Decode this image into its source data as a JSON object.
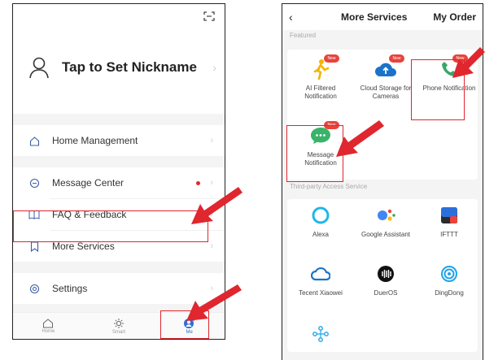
{
  "left_phone": {
    "nickname": "Tap to Set Nickname",
    "menu": [
      {
        "label": "Home Management",
        "icon": "home-icon"
      },
      {
        "label": "Message Center",
        "icon": "message-icon",
        "has_dot": true
      },
      {
        "label": "FAQ & Feedback",
        "icon": "book-icon"
      },
      {
        "label": "More Services",
        "icon": "bookmark-icon",
        "highlighted": true
      },
      {
        "label": "Settings",
        "icon": "settings-icon"
      }
    ],
    "tabs": [
      {
        "label": "Home",
        "icon": "home-tab-icon"
      },
      {
        "label": "Smart",
        "icon": "sun-icon"
      },
      {
        "label": "Me",
        "icon": "me-icon",
        "active": true
      }
    ]
  },
  "right_phone": {
    "title": "More Services",
    "my_order": "My Order",
    "featured_label": "Featured",
    "third_party_label": "Third-party Access Service",
    "new_badge": "New",
    "featured": [
      {
        "name": "AI Filtered Notification",
        "icon": "ai-filter-icon"
      },
      {
        "name": "Cloud Storage for Cameras",
        "icon": "cloud-upload-icon"
      },
      {
        "name": "Phone Notification",
        "icon": "phone-icon",
        "highlighted": true
      },
      {
        "name": "Message Notification",
        "icon": "chat-icon",
        "highlighted": true
      }
    ],
    "third_party": [
      {
        "name": "Alexa",
        "icon": "alexa-icon"
      },
      {
        "name": "Google Assistant",
        "icon": "google-assistant-icon"
      },
      {
        "name": "IFTTT",
        "icon": "ifttt-icon"
      },
      {
        "name": "Tecent Xiaowei",
        "icon": "xiaowei-icon"
      },
      {
        "name": "DuerOS",
        "icon": "dueros-icon"
      },
      {
        "name": "DingDong",
        "icon": "dingdong-icon"
      },
      {
        "name": "",
        "icon": "network-icon"
      }
    ]
  },
  "colors": {
    "annotation_red": "#e0262e",
    "accent_blue": "#2f6fd6",
    "badge_red": "#e8433c"
  }
}
